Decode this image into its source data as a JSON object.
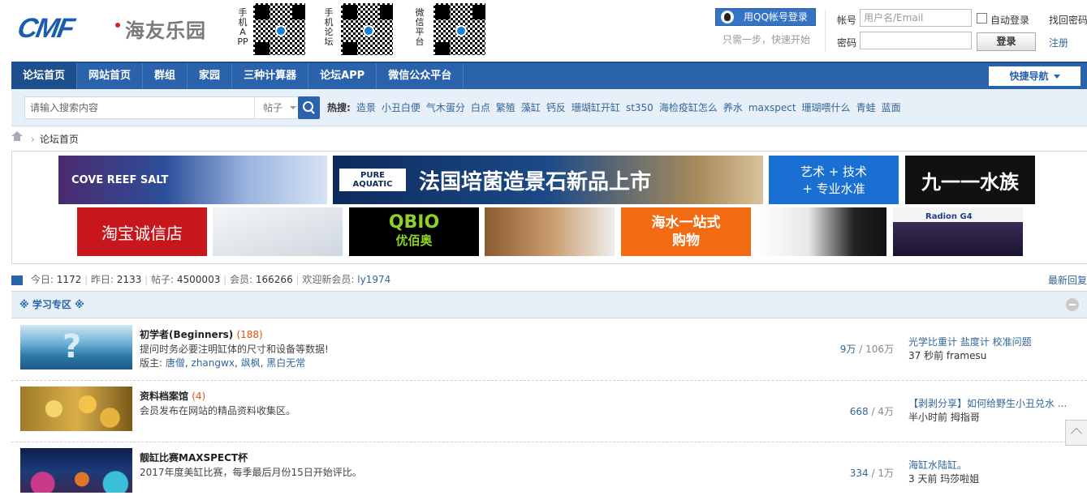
{
  "header": {
    "logo_text": "CMF",
    "logo_cn": "海友乐园",
    "qr_codes": [
      {
        "label": "手机APP"
      },
      {
        "label": "手机论坛"
      },
      {
        "label": "微信平台"
      }
    ],
    "qq_login_label": "用QQ帐号登录",
    "qq_tip": "只需一步，快速开始",
    "account_label": "帐号",
    "account_placeholder": "用户名/Email",
    "password_label": "密码",
    "auto_login": "自动登录",
    "login_button": "登录",
    "find_password": "找回密码",
    "register": "注册"
  },
  "nav": {
    "items": [
      "论坛首页",
      "网站首页",
      "群组",
      "家园",
      "三种计算器",
      "论坛APP",
      "微信公众平台"
    ],
    "active": 0,
    "quick_nav": "快捷导航"
  },
  "search": {
    "placeholder": "请输入搜索内容",
    "type": "帖子",
    "hot_label": "热搜:",
    "hot": [
      "造景",
      "小丑白便",
      "气木蛋分",
      "白点",
      "繁殖",
      "藻缸",
      "钙反",
      "珊瑚缸开缸",
      "st350",
      "海检疫缸怎么",
      "养水",
      "maxspect",
      "珊瑚喂什么",
      "青蛙",
      "蓝面"
    ]
  },
  "breadcrumb": {
    "current": "论坛首页"
  },
  "ads": {
    "row1": [
      "COVE  REEF SALT",
      "PURE AQUATIC",
      "法国培菌造景石新品上市",
      "艺术 + 技术",
      "+ 专业水准",
      "九一一水族"
    ],
    "row2": [
      "淘宝诚信店",
      "QBIO",
      "优佰奥",
      "海水一站式",
      "购物",
      "Radion G4"
    ]
  },
  "stats": {
    "today_label": "今日:",
    "today": "1172",
    "yesterday_label": "昨日:",
    "yesterday": "2133",
    "posts_label": "帖子:",
    "posts": "4500003",
    "members_label": "会员:",
    "members": "166266",
    "newest_label": "欢迎新会员:",
    "newest": "ly1974",
    "latest_reply": "最新回复"
  },
  "category": {
    "title": "※ 学习专区 ※"
  },
  "forums": [
    {
      "name": "初学者(Beginners)",
      "count": "(188)",
      "desc": "提问时务必要注明缸体的尺寸和设备等数据!",
      "mod_label": "版主:",
      "mods": [
        "唐僧",
        "zhangwx",
        "飒枫",
        "黑白无常"
      ],
      "threads": "9万",
      "posts": "106万",
      "last_title": "光学比重计 盐度计 校准问题",
      "last_meta": "37 秒前 framesu"
    },
    {
      "name": "资料档案馆",
      "count": "(4)",
      "desc": "会员发布在网站的精品资料收集区。",
      "mod_label": "",
      "mods": [],
      "threads": "668",
      "posts": "4万",
      "last_title": "【剥剥分享】如何给野生小丑兑水 ...",
      "last_meta": "半小时前 拇指哥"
    },
    {
      "name": "靓缸比赛MAXSPECT杯",
      "count": "",
      "desc": "2017年度美缸比赛，每季最后月份15日开始评比。",
      "mod_label": "",
      "mods": [],
      "threads": "334",
      "posts": "1万",
      "last_title": "海缸水陆缸。",
      "last_meta": "3 天前 玛莎啦姐"
    }
  ],
  "colors": {
    "nav_blue": "#2a63ac",
    "link": "#336699",
    "count_orange": "#e0520c"
  }
}
